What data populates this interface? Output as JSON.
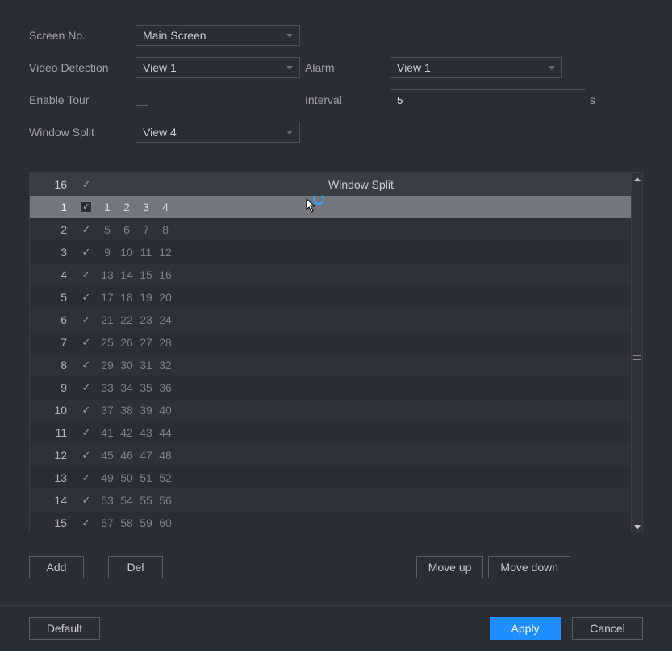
{
  "form": {
    "screen_no_label": "Screen No.",
    "screen_no_value": "Main Screen",
    "video_detection_label": "Video Detection",
    "video_detection_value": "View 1",
    "alarm_label": "Alarm",
    "alarm_value": "View 1",
    "enable_tour_label": "Enable Tour",
    "enable_tour_checked": false,
    "interval_label": "Interval",
    "interval_value": "5",
    "interval_unit": "s",
    "window_split_label": "Window Split",
    "window_split_value": "View 4"
  },
  "table": {
    "header_count": "16",
    "header_split": "Window Split",
    "rows": [
      {
        "idx": "1",
        "checked": true,
        "selected": true,
        "cells": [
          "1",
          "2",
          "3",
          "4"
        ]
      },
      {
        "idx": "2",
        "checked": true,
        "selected": false,
        "cells": [
          "5",
          "6",
          "7",
          "8"
        ]
      },
      {
        "idx": "3",
        "checked": true,
        "selected": false,
        "cells": [
          "9",
          "10",
          "11",
          "12"
        ]
      },
      {
        "idx": "4",
        "checked": true,
        "selected": false,
        "cells": [
          "13",
          "14",
          "15",
          "16"
        ]
      },
      {
        "idx": "5",
        "checked": true,
        "selected": false,
        "cells": [
          "17",
          "18",
          "19",
          "20"
        ]
      },
      {
        "idx": "6",
        "checked": true,
        "selected": false,
        "cells": [
          "21",
          "22",
          "23",
          "24"
        ]
      },
      {
        "idx": "7",
        "checked": true,
        "selected": false,
        "cells": [
          "25",
          "26",
          "27",
          "28"
        ]
      },
      {
        "idx": "8",
        "checked": true,
        "selected": false,
        "cells": [
          "29",
          "30",
          "31",
          "32"
        ]
      },
      {
        "idx": "9",
        "checked": true,
        "selected": false,
        "cells": [
          "33",
          "34",
          "35",
          "36"
        ]
      },
      {
        "idx": "10",
        "checked": true,
        "selected": false,
        "cells": [
          "37",
          "38",
          "39",
          "40"
        ]
      },
      {
        "idx": "11",
        "checked": true,
        "selected": false,
        "cells": [
          "41",
          "42",
          "43",
          "44"
        ]
      },
      {
        "idx": "12",
        "checked": true,
        "selected": false,
        "cells": [
          "45",
          "46",
          "47",
          "48"
        ]
      },
      {
        "idx": "13",
        "checked": true,
        "selected": false,
        "cells": [
          "49",
          "50",
          "51",
          "52"
        ]
      },
      {
        "idx": "14",
        "checked": true,
        "selected": false,
        "cells": [
          "53",
          "54",
          "55",
          "56"
        ]
      },
      {
        "idx": "15",
        "checked": true,
        "selected": false,
        "cells": [
          "57",
          "58",
          "59",
          "60"
        ]
      }
    ]
  },
  "buttons": {
    "add": "Add",
    "del": "Del",
    "move_up": "Move up",
    "move_down": "Move down",
    "default": "Default",
    "apply": "Apply",
    "cancel": "Cancel"
  }
}
